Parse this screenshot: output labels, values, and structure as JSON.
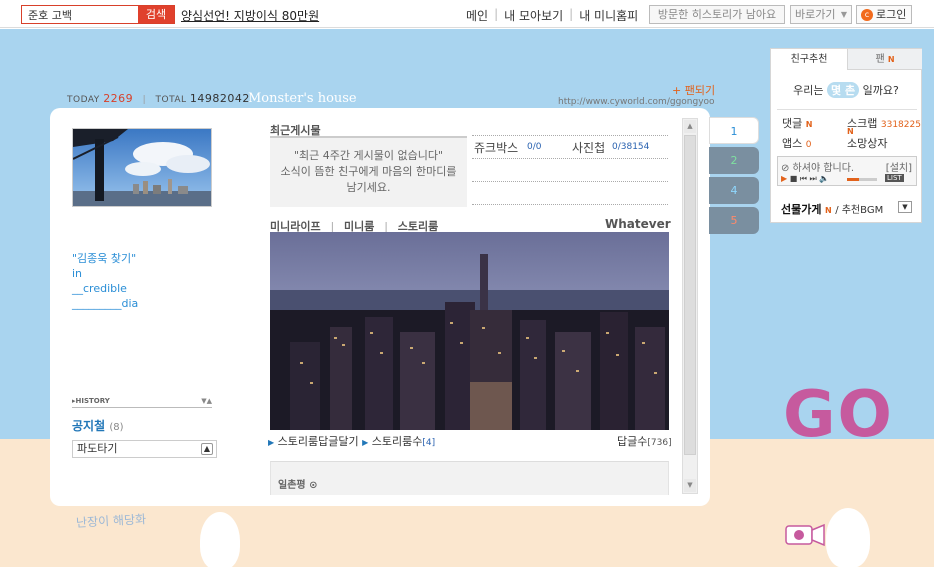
{
  "topbar": {
    "search_value": "준호 고백",
    "search_button": "검색",
    "headline": "양심선언! 지방이식 80만원",
    "nav": [
      "메인",
      "내 모아보기",
      "내 미니홈피"
    ],
    "visit_history": "방문한 히스토리가 남아요",
    "goto": "바로가기",
    "login": "로그인"
  },
  "stats": {
    "today_label": "TODAY",
    "today_value": "2269",
    "total_label": "TOTAL",
    "total_value": "14982042"
  },
  "home": {
    "title": "Monster's house",
    "fan_link": "팬되기",
    "url": "http://www.cyworld.com/ggongyoo"
  },
  "profile": {
    "lines": [
      "\"김종욱 찾기\"",
      "in",
      "__credible",
      "_________dia"
    ],
    "history_label": "HISTORY",
    "notice_title": "공지철",
    "notice_count": "(8)",
    "folder_select": "파도타기"
  },
  "recent": {
    "title": "최근게시물",
    "message_line1": "\"최근 4주간 게시물이 없습니다\"",
    "message_line2": "소식이 뜸한 친구에게 마음의 한마디를",
    "message_line3": "남기세요.",
    "jukebox_label": "쥬크박스",
    "jukebox_count": "0/0",
    "album_label": "사진첩",
    "album_count": "0/38154"
  },
  "story": {
    "tabs": [
      "미니라이프",
      "미니룸",
      "스토리룸"
    ],
    "caption": "Whatever",
    "reply_link": "스토리룸답글달기",
    "count_label": "스토리룸수",
    "count_value": "[4]",
    "reply_count_label": "답글수",
    "reply_count_value": "[736]",
    "guestbook": "일촌평"
  },
  "side_tabs": [
    "1",
    "2",
    "4",
    "5"
  ],
  "right_panel": {
    "tab_friends": "친구추천",
    "tab_fan": "팬",
    "new_mark": "N",
    "ask_before": "우리는",
    "ask_pill": "몇 촌",
    "ask_after": "일까요?",
    "comments_label": "댓글",
    "scrap_label": "스크랩",
    "scrap_count": "3318225",
    "apps_label": "앱스",
    "apps_count": "0",
    "wish_label": "소망상자",
    "bgm_notice": "⊘ 하셔야 합니다.",
    "bgm_install": "[설치]",
    "bgm_list": "LIST",
    "gift_label": "선물가게",
    "recommend_label": "/ 추천BGM"
  },
  "decor": {
    "go_text": "GO",
    "handwriting": "난장이 해당화"
  },
  "colors": {
    "sky": "#a9d4ef",
    "floor": "#fbe7cf",
    "accent_red": "#e0402c",
    "accent_orange": "#e2621b",
    "go_pink": "#c65a9e"
  }
}
